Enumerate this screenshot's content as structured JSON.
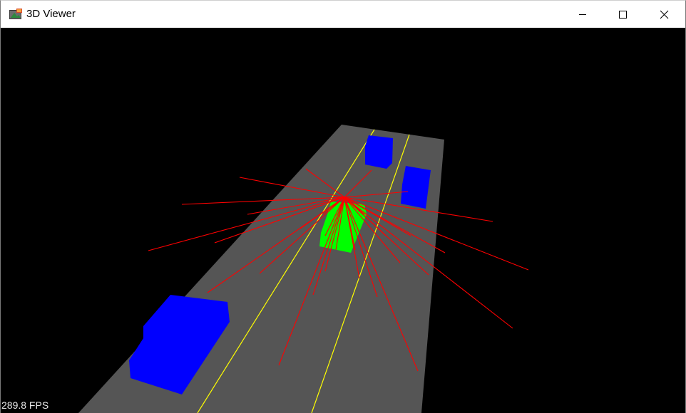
{
  "window": {
    "title": "3D Viewer",
    "icons": {
      "app": "app-icon",
      "minimize": "minimize-icon",
      "maximize": "maximize-icon",
      "close": "close-icon"
    }
  },
  "scene": {
    "background_color": "#000000",
    "road_color": "#555555",
    "lane_line_color": "#ffff00",
    "ego_vehicle_color": "#00ff00",
    "other_vehicle_color": "#0000ff",
    "ray_color": "#ff0000",
    "other_vehicle_count": 3,
    "lane_line_count": 2
  },
  "status": {
    "fps": "289.8 FPS"
  }
}
